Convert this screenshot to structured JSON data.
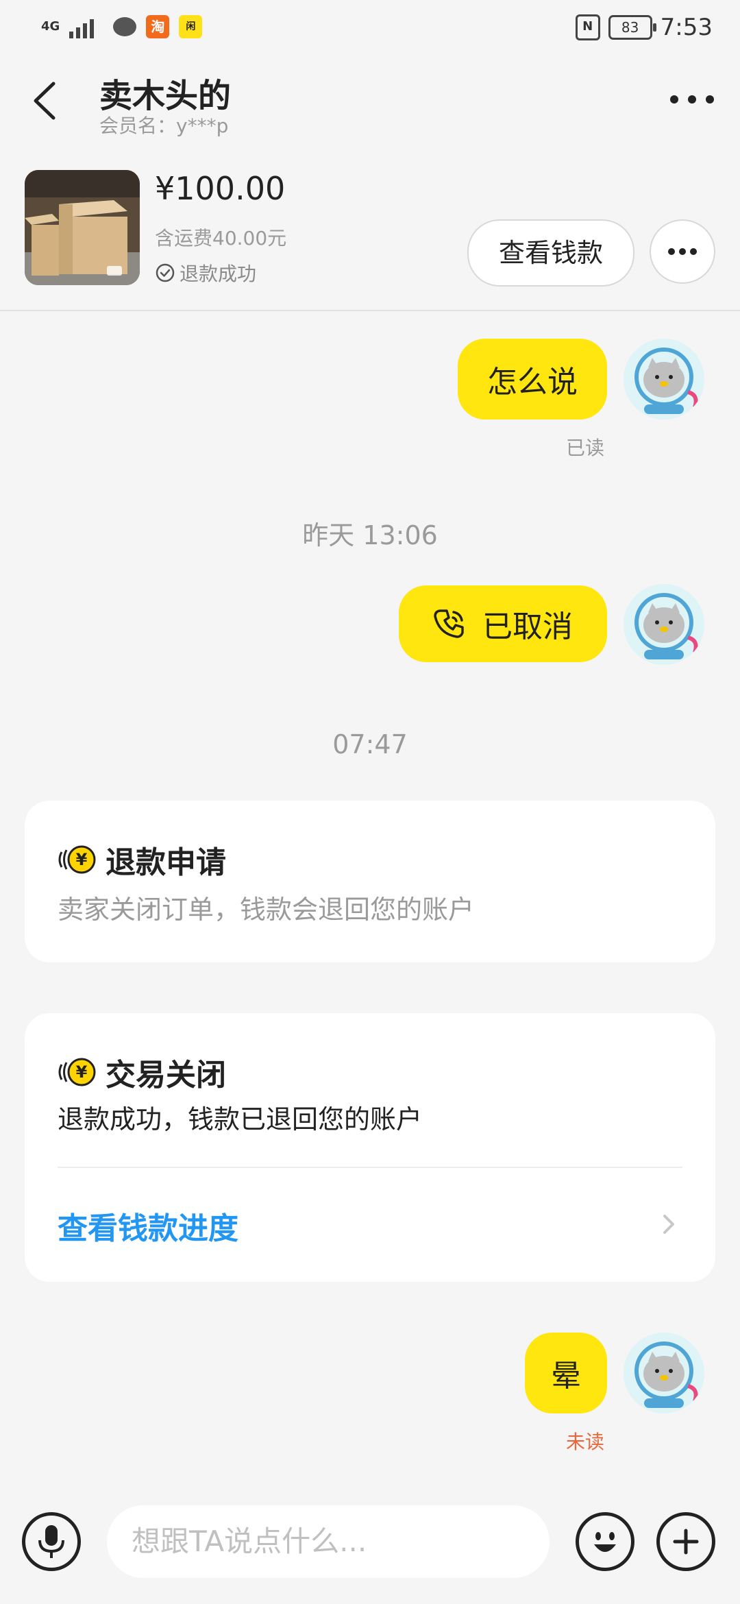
{
  "status_bar": {
    "network": "4G",
    "app1_label": "淘",
    "app2_label": "闲",
    "battery": "83",
    "time": "7:53"
  },
  "header": {
    "title": "卖木头的",
    "subtitle": "会员名：y***p"
  },
  "product": {
    "price": "¥100.00",
    "shipping": "含运费40.00元",
    "status": "退款成功",
    "view_money_label": "查看钱款"
  },
  "chat": {
    "msg1": "怎么说",
    "msg1_status": "已读",
    "time1": "昨天 13:06",
    "call_text": "已取消",
    "time2": "07:47",
    "card1": {
      "title": "退款申请",
      "desc": "卖家关闭订单，钱款会退回您的账户"
    },
    "card2": {
      "title": "交易关闭",
      "desc": "退款成功，钱款已退回您的账户",
      "link": "查看钱款进度"
    },
    "msg2": "晕",
    "msg2_status": "未读"
  },
  "input": {
    "placeholder": "想跟TA说点什么..."
  },
  "colors": {
    "bubble": "#ffe60f",
    "link": "#2196f3",
    "unread": "#e8683b"
  }
}
